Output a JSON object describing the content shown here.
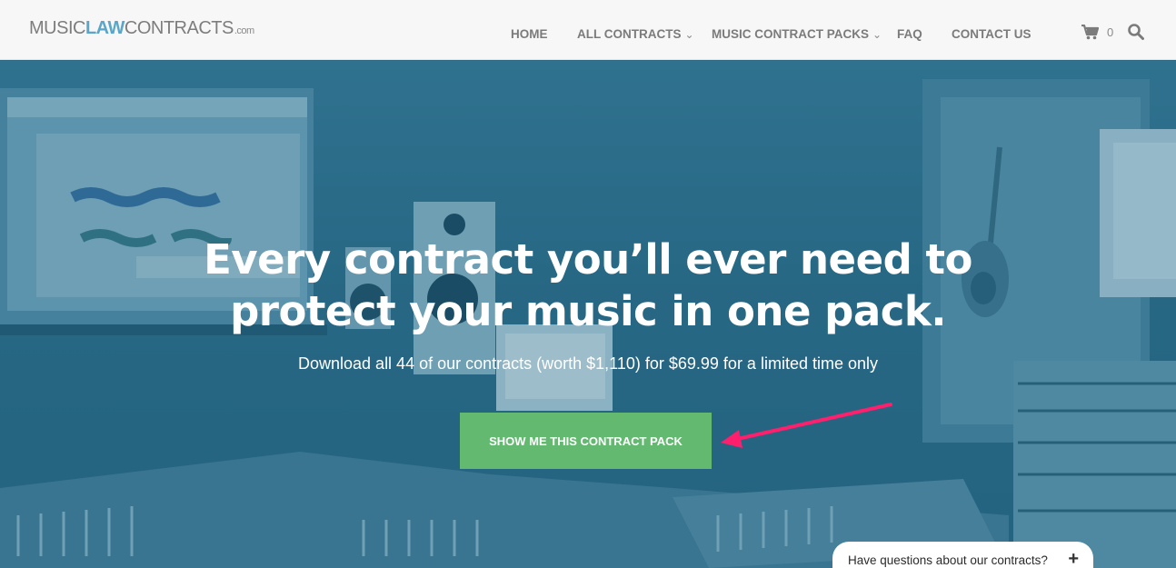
{
  "brand": {
    "part1": "MUSIC",
    "part2": "LAW",
    "part3": "CONTRACTS",
    "suffix": ".com"
  },
  "nav": {
    "items": [
      {
        "label": "HOME"
      },
      {
        "label": "ALL CONTRACTS"
      },
      {
        "label": "MUSIC CONTRACT PACKS"
      },
      {
        "label": "FAQ"
      },
      {
        "label": "CONTACT US"
      }
    ],
    "cart_count": "0",
    "icons": [
      "shopping-cart-icon",
      "search-icon",
      "chevron-down-icon"
    ]
  },
  "hero": {
    "headline_line1": "Every contract you’ll ever need to",
    "headline_line2": "protect your music in one pack.",
    "subline": "Download all 44 of our contracts (worth $1,110) for $69.99 for a limited time only",
    "cta_label": "SHOW ME THIS CONTRACT PACK"
  },
  "chat": {
    "label": "Have questions about our contracts?",
    "icon": "plus-icon"
  },
  "colors": {
    "accent": "#5aa6c8",
    "cta": "#63b96f",
    "arrow": "#ff1f6d",
    "hero": "#2f6b85"
  }
}
